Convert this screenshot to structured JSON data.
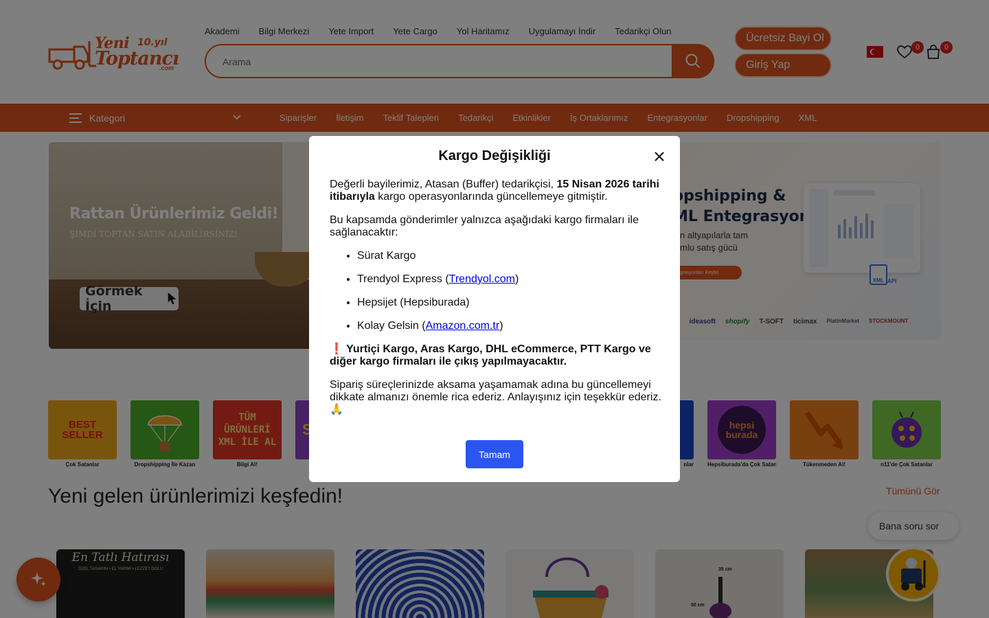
{
  "brand": {
    "line1": "Yeni",
    "line2": "Toptancı",
    "years": "10.yıl",
    "tld": ".com"
  },
  "topnav": [
    "Akademi",
    "Bilgi Merkezi",
    "Yete Import",
    "Yete Cargo",
    "Yol Haritamız",
    "Uygulamayı İndir",
    "Tedarikçi Olun"
  ],
  "search": {
    "placeholder": "Arama"
  },
  "header_buttons": {
    "register": "Ücretsiz Bayi Ol",
    "login": "Giriş Yap"
  },
  "badges": {
    "favorites": "0",
    "cart": "0"
  },
  "catbar": {
    "kategori": "Kategori",
    "links": [
      "Siparişler",
      "İletişim",
      "Teklif Talepleri",
      "Tedarikçi",
      "Etkinlikler",
      "İş Ortaklarımız",
      "Entegrasyonlar",
      "Dropshipping",
      "XML"
    ]
  },
  "banner_left": {
    "title": "Rattan Ürünlerimiz Geldi!",
    "subtitle": "ŞİMDİ TOPTAN SATIN ALABİLİRSİNİZ!",
    "button": "Görmek İçin"
  },
  "banner_right": {
    "title1": "opshipping &",
    "title2": "ML Entegrasyon",
    "desc1": "n altyapılarla tam",
    "desc2": "mlu satış gücü",
    "pill": "grasyonları Keşfet",
    "xml_label": "XML",
    "api_label": "API",
    "partners": [
      "s",
      "ideasoft",
      "shopify",
      "T-SOFT",
      "ticimax",
      "PlatinMarket",
      "STOCKMOUNT"
    ]
  },
  "tiles": [
    {
      "caption": "Çok Satanlar",
      "art": "BEST SELLER",
      "color": "#f3a81b"
    },
    {
      "caption": "Dropshipping İle Kazan",
      "art": "",
      "color": "#4caf28"
    },
    {
      "caption": "Bilgi Al!",
      "art": "TÜM ÜRÜNLERİ XML İLE AL",
      "color": "#e53626"
    },
    {
      "caption": "",
      "art": "S",
      "color": "#8e44c4"
    },
    {
      "caption": "nlar",
      "art": "",
      "color": "#1c47c8"
    },
    {
      "caption": "Hepsiburada'da Çok Satanlar",
      "art": "hepsi burada",
      "color": "#a23fd0"
    },
    {
      "caption": "Tükenmeden Al!",
      "art": "",
      "color": "#f2801f"
    },
    {
      "caption": "n11'de Çok Satanlar",
      "art": "",
      "color": "#7ed04b"
    }
  ],
  "section": {
    "title": "Yeni gelen ürünlerimizi keşfedin!",
    "see_all": "Tümünü Gör"
  },
  "product_1": {
    "title": "En Tatlı Hatırası",
    "subtitle": "ÖZEL TASARIM • EL YAPIMI • LEZZET DOLU"
  },
  "product_5": {
    "label_top": "35 cm",
    "label_side": "50 cm"
  },
  "ask_button": "Bana soru sor",
  "modal": {
    "title": "Kargo Değişikliği",
    "p1_pre": "Değerli bayilerimiz, Atasan (Buffer) tedarikçisi, ",
    "p1_bold": "15 Nisan 2026 tarihi itibarıyla",
    "p1_post": " kargo operasyonlarında güncellemeye gitmiştir.",
    "p2": "Bu kapsamda gönderimler yalnızca aşağıdaki kargo firmaları ile sağlanacaktır:",
    "items": [
      {
        "text": "Sürat Kargo",
        "link": "",
        "suffix": ""
      },
      {
        "text": "Trendyol Express (",
        "link": "Trendyol.com",
        "suffix": ")"
      },
      {
        "text": "Hepsijet (Hepsiburada)",
        "link": "",
        "suffix": ""
      },
      {
        "text": "Kolay Gelsin (",
        "link": "Amazon.com.tr",
        "suffix": ")"
      }
    ],
    "warning_icon": "❗",
    "warning": " Yurtiçi Kargo, Aras Kargo, DHL eCommerce, PTT Kargo ve diğer kargo firmaları ile çıkış yapılmayacaktır.",
    "p3": "Sipariş süreçlerinizde aksama yaşamamak adına bu güncellemeyi dikkate almanızı önemle rica ederiz. Anlayışınız için teşekkür ederiz. 🙏",
    "ok": "Tamam"
  },
  "colors": {
    "accent": "#e0551f",
    "primary_button": "#2b55f0",
    "badge": "#e0231f"
  }
}
